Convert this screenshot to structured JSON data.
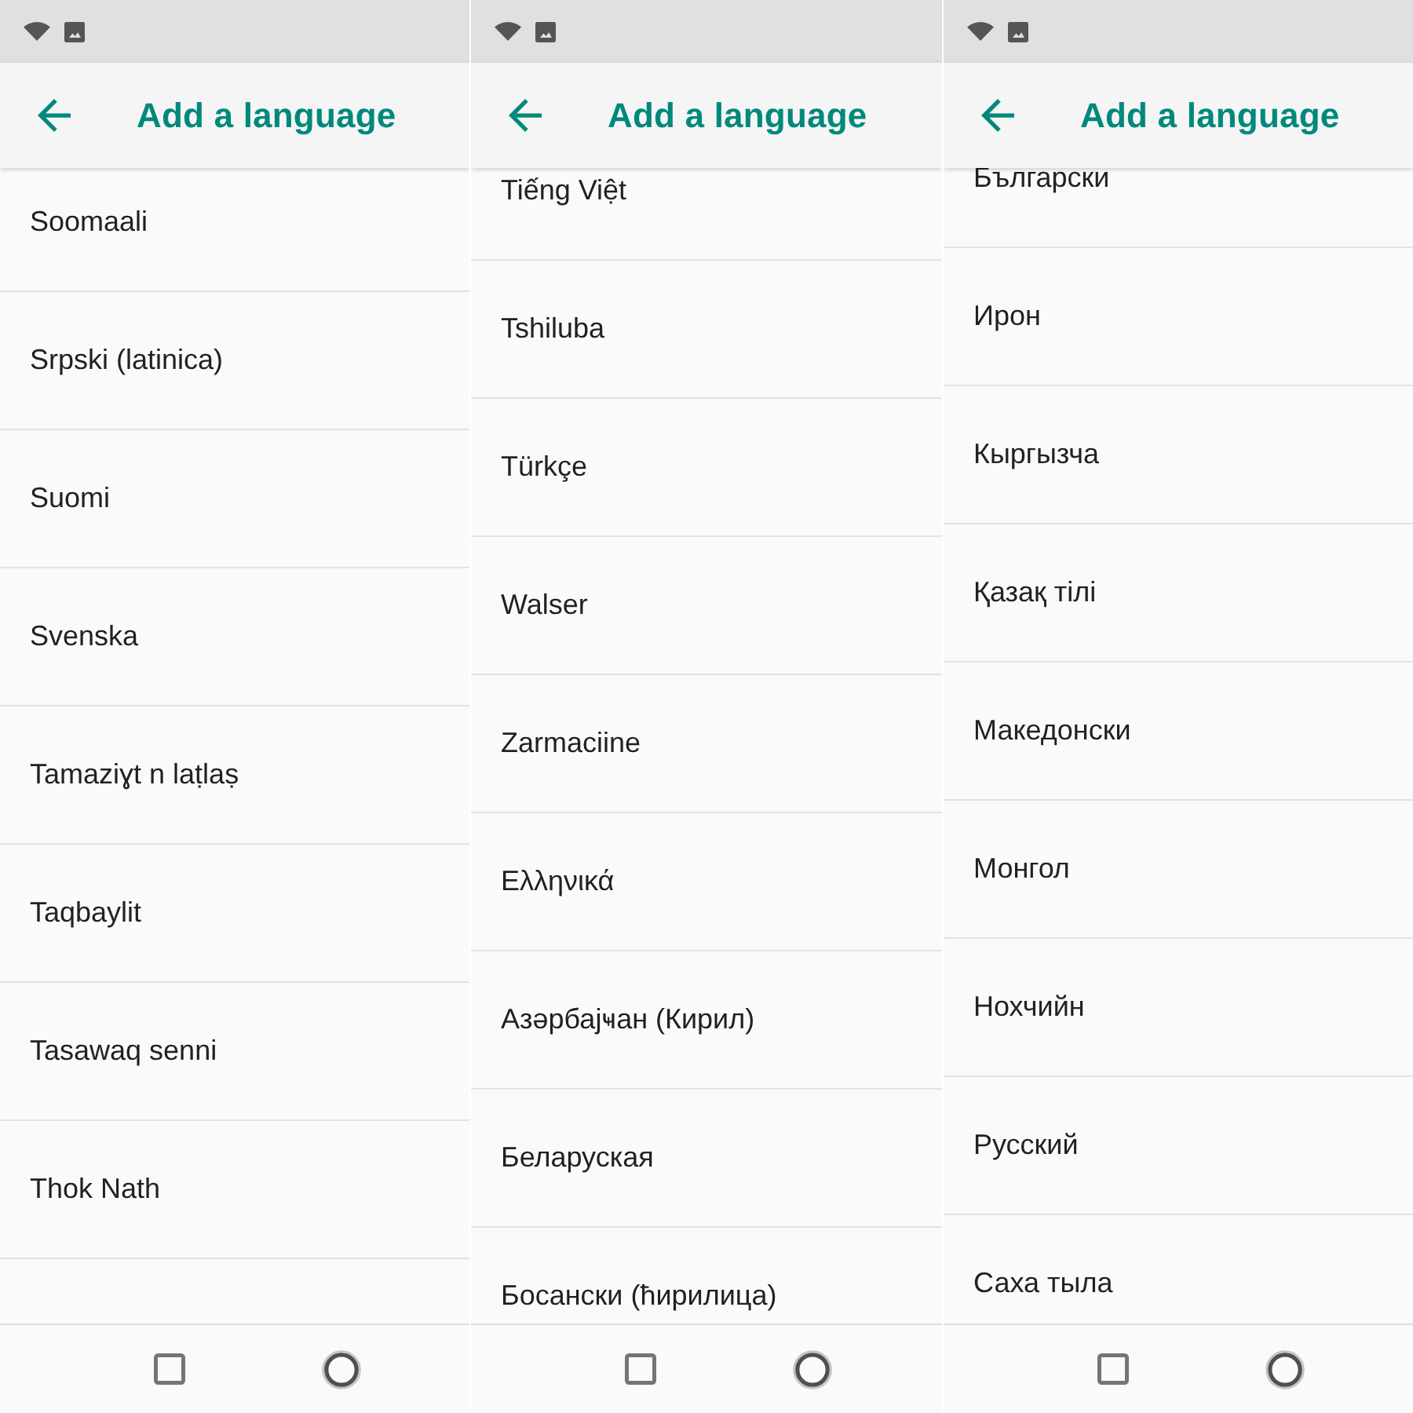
{
  "screens": [
    {
      "title": "Add a language",
      "languages": [
        "Soomaali",
        "Srpski (latinica)",
        "Suomi",
        "Svenska",
        "Tamaziɣt n laṭlaṣ",
        "Taqbaylit",
        "Tasawaq senni",
        "Thok Nath"
      ]
    },
    {
      "title": "Add a language",
      "languages": [
        "Tiếng Việt",
        "Tshiluba",
        "Türkçe",
        "Walser",
        "Zarmaciine",
        "Ελληνικά",
        "Азәрбајҹан (Кирил)",
        "Беларуская",
        "Босански (ћирилица)"
      ]
    },
    {
      "title": "Add a language",
      "languages": [
        "Български",
        "Ирон",
        "Кыргызча",
        "Қазақ тілі",
        "Македонски",
        "Монгол",
        "Нохчийн",
        "Русский",
        "Саха тыла"
      ]
    }
  ]
}
